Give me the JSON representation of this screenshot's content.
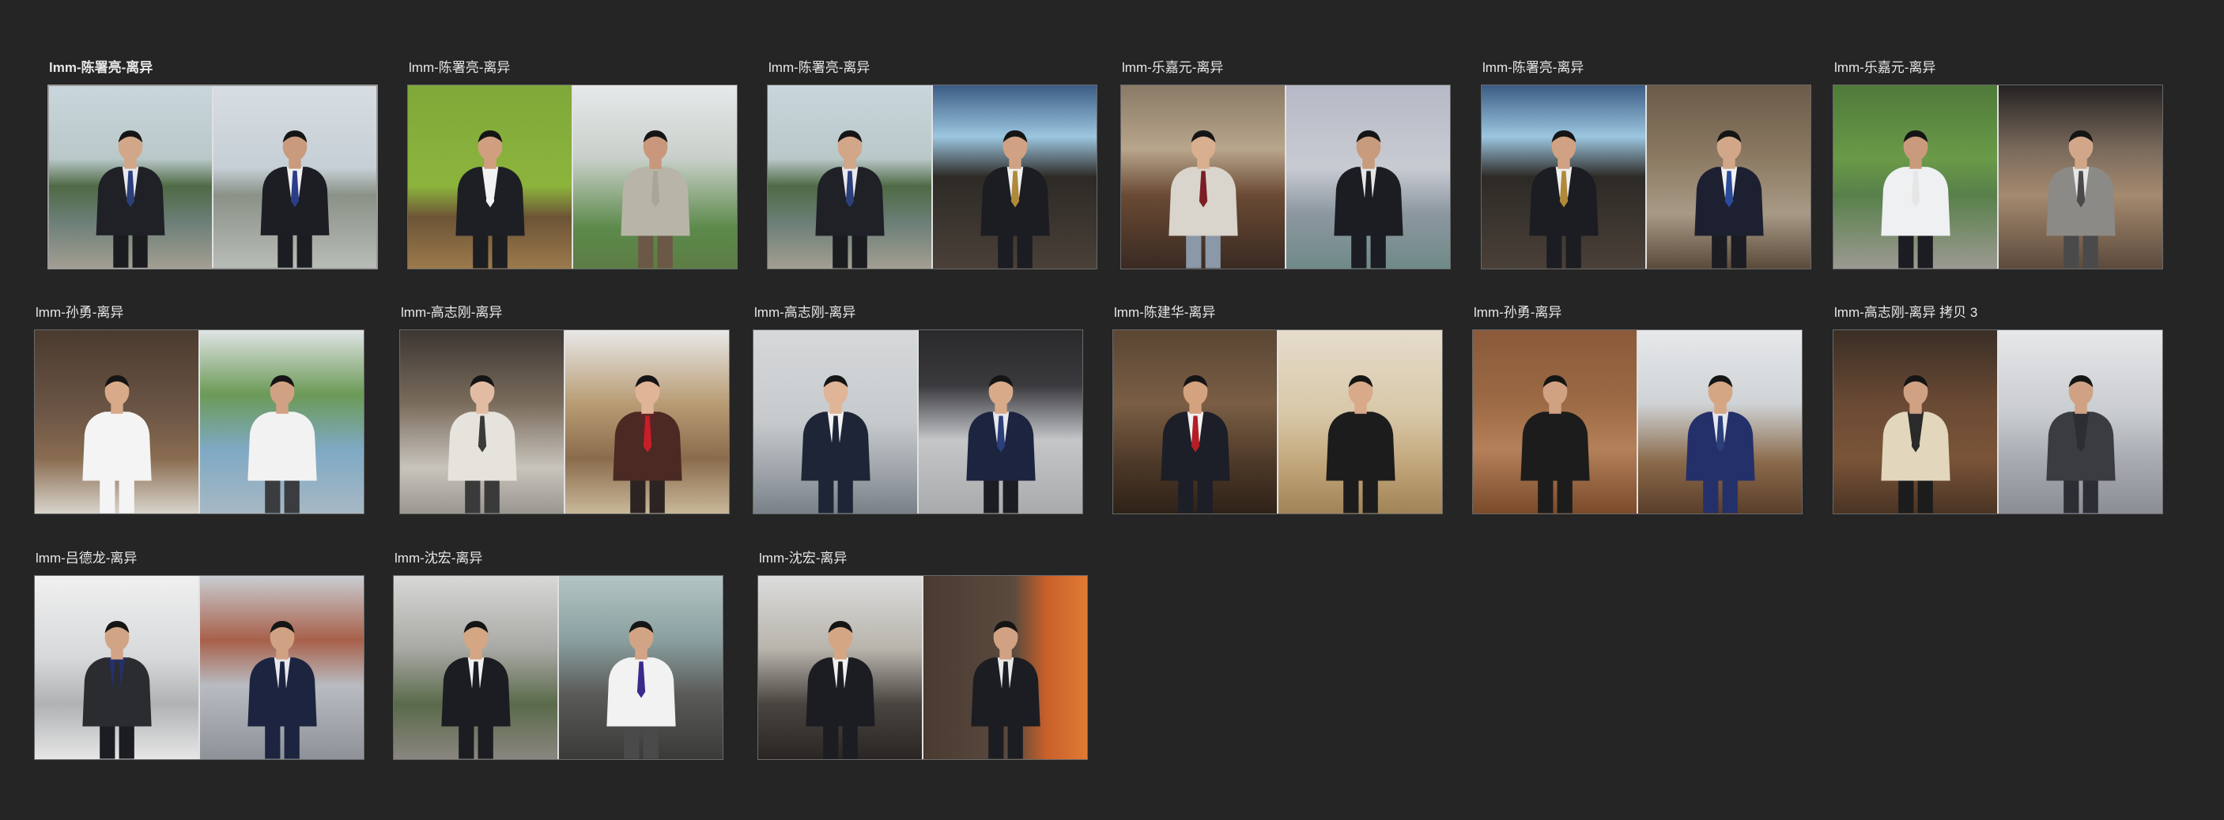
{
  "tiles": [
    {
      "label": "lmm-陈署亮-离异",
      "bold": true,
      "selected": true,
      "photos": [
        {
          "bg": "linear-gradient(180deg,#c9d6dc 0%,#b9c8c9 40%,#4f6a45 55%,#6c7f78 75%,#a39e92 100%)",
          "skin": "#d2a688",
          "shirt": "#e8e8ee",
          "jacket": "#1f2127",
          "tie": "#2b3f7a",
          "pants": "#1b1c20"
        },
        {
          "bg": "linear-gradient(180deg,#d7dde2 0%,#c6cfd6 45%,#8a9187 60%,#b8bdb7 100%)",
          "skin": "#c99a7c",
          "shirt": "#f0f0f0",
          "jacket": "#1c1e24",
          "tie": "#2b3d8a",
          "pants": "#1c1d22"
        }
      ]
    },
    {
      "label": "lmm-陈署亮-离异",
      "bold": false,
      "selected": false,
      "photos": [
        {
          "bg": "linear-gradient(180deg,#7fa83a 0%,#8cb43c 55%,#6d5436 72%,#9b7a4c 100%)",
          "skin": "#cf9f7f",
          "shirt": "#f2f2f2",
          "jacket": "#1e1f25",
          "tie": "#f2f2f2",
          "pants": "#1d1e22"
        },
        {
          "bg": "linear-gradient(180deg,#e6e9ea 0%,#c8cfc9 40%,#5c8a4b 78%,#5d7d45 100%)",
          "skin": "#c9977b",
          "shirt": "#b8b5a8",
          "jacket": "#b8b5a8",
          "tie": "#a9a699",
          "pants": "#6c5846"
        }
      ]
    },
    {
      "label": "lmm-陈署亮-离异",
      "bold": false,
      "selected": false,
      "photos": [
        {
          "bg": "linear-gradient(180deg,#c9d6dc 0%,#b9c8c9 40%,#4f6a45 55%,#6c7f78 75%,#a39e92 100%)",
          "skin": "#d2a688",
          "shirt": "#e8e8ee",
          "jacket": "#1f2127",
          "tie": "#2b3f7a",
          "pants": "#1b1c20"
        },
        {
          "bg": "linear-gradient(180deg,#3b5c84 0%,#9cc6e0 28%,#2d2a26 50%,#4a4038 100%)",
          "skin": "#d0a283",
          "shirt": "#f0f0f0",
          "jacket": "#1c1d22",
          "tie": "#b08a3a",
          "pants": "#1c1d22"
        }
      ]
    },
    {
      "label": "lmm-乐嘉元-离异",
      "bold": false,
      "selected": false,
      "photos": [
        {
          "bg": "linear-gradient(180deg,#8a7a66 0%,#b8a58c 35%,#6a4a34 60%,#3a2a22 100%)",
          "skin": "#d8b08f",
          "shirt": "#d9d4cc",
          "jacket": "#d9d4cc",
          "tie": "#7a1f25",
          "pants": "#8a98a8"
        },
        {
          "bg": "linear-gradient(180deg,#b6b9c6 0%,#c9cbd3 45%,#8c97a0 70%,#6f8a88 100%)",
          "skin": "#c89b7c",
          "shirt": "#e6e6e6",
          "jacket": "#1c1d22",
          "tie": "#1c1d22",
          "pants": "#1c1d22"
        }
      ]
    },
    {
      "label": "lmm-陈署亮-离异",
      "bold": false,
      "selected": false,
      "photos": [
        {
          "bg": "linear-gradient(180deg,#3b5c84 0%,#9cc6e0 28%,#2d2a26 50%,#4a4038 100%)",
          "skin": "#d0a283",
          "shirt": "#f0f0f0",
          "jacket": "#1c1d22",
          "tie": "#b08a3a",
          "pants": "#1c1d22"
        },
        {
          "bg": "linear-gradient(180deg,#6b5a48 0%,#8c7a63 40%,#a89a86 70%,#5a4a3a 100%)",
          "skin": "#d2a688",
          "shirt": "#f2f2f2",
          "jacket": "#1d2030",
          "tie": "#2b4a9a",
          "pants": "#1c1d22"
        }
      ]
    },
    {
      "label": "lmm-乐嘉元-离异",
      "bold": false,
      "selected": false,
      "photos": [
        {
          "bg": "linear-gradient(180deg,#4f7a3a 0%,#6a9a48 40%,#58804a 60%,#9c9a92 100%)",
          "skin": "#c99a7c",
          "shirt": "#eef0f2",
          "jacket": "#eef0f2",
          "tie": "#e6e6e6",
          "pants": "#1c1d22"
        },
        {
          "bg": "linear-gradient(180deg,#242222 0%,#7a6a5c 35%,#a48a6e 60%,#5c4a3c 100%)",
          "skin": "#d2a688",
          "shirt": "#e6e6e6",
          "jacket": "#8c8a86",
          "tie": "#4a4a4a",
          "pants": "#4a4a4a"
        }
      ]
    },
    {
      "label": "lmm-孙勇-离异",
      "bold": false,
      "selected": false,
      "photos": [
        {
          "bg": "linear-gradient(180deg,#4a3a2e 0%,#6c5646 45%,#8a6c50 70%,#d8d4cc 100%)",
          "skin": "#d8aa8a",
          "shirt": "#f4f4f4",
          "jacket": "#f4f4f4",
          "tie": "#f4f4f4",
          "pants": "#f4f4f4"
        },
        {
          "bg": "linear-gradient(180deg,#dfe4e6 0%,#6c9a56 35%,#7ea9c4 65%,#a7b8c4 100%)",
          "skin": "#d0a283",
          "shirt": "#f2f2f2",
          "jacket": "#f2f2f2",
          "tie": "#f2f2f2",
          "pants": "#3a3c40"
        }
      ]
    },
    {
      "label": "lmm-高志刚-离异",
      "bold": false,
      "selected": false,
      "photos": [
        {
          "bg": "linear-gradient(180deg,#3c3632 0%,#7a6c5c 40%,#c8c4bc 75%,#9a9690 100%)",
          "skin": "#e2bca2",
          "shirt": "#e6e2dc",
          "jacket": "#e6e2dc",
          "tie": "#3a3a3a",
          "pants": "#3a3a3a"
        },
        {
          "bg": "linear-gradient(180deg,#e8e8e8 0%,#b89c74 40%,#8a6c4c 70%,#c8b89a 100%)",
          "skin": "#e0b496",
          "shirt": "#5a2424",
          "jacket": "#4a2a22",
          "tie": "#c81e28",
          "pants": "#2c2422"
        }
      ]
    },
    {
      "label": "lmm-高志刚-离异",
      "bold": false,
      "selected": false,
      "photos": [
        {
          "bg": "linear-gradient(180deg,#d6d8da 0%,#c6cacc 50%,#9aa0a6 80%,#7a8088 100%)",
          "skin": "#e0b496",
          "shirt": "#f2f2f2",
          "jacket": "#1e2536",
          "tie": "#1e2536",
          "pants": "#1e2536"
        },
        {
          "bg": "linear-gradient(180deg,#2a2a2c 0%,#3a3a3e 30%,#c4c6c8 60%,#a8aaac 100%)",
          "skin": "#d8aa8a",
          "shirt": "#e8e8ee",
          "jacket": "#1c2440",
          "tie": "#2b3f7a",
          "pants": "#1c1d22"
        }
      ]
    },
    {
      "label": "lmm-陈建华-离异",
      "bold": false,
      "selected": false,
      "photos": [
        {
          "bg": "linear-gradient(180deg,#5a4634 0%,#7a5e44 40%,#4a3626 75%,#2e2218 100%)",
          "skin": "#d4a27e",
          "shirt": "#f2f2f2",
          "jacket": "#1c1e28",
          "tie": "#b41e24",
          "pants": "#1c1e28"
        },
        {
          "bg": "linear-gradient(180deg,#e6dccc 0%,#d8c8a8 45%,#c0a478 75%,#a08458 100%)",
          "skin": "#d8aa8a",
          "shirt": "#1c1c1c",
          "jacket": "#1c1c1c",
          "tie": "#1c1c1c",
          "pants": "#1c1c1c"
        }
      ]
    },
    {
      "label": "lmm-孙勇-离异",
      "bold": false,
      "selected": false,
      "photos": [
        {
          "bg": "linear-gradient(180deg,#8a5a3a 0%,#9c6a44 40%,#b4805a 65%,#7a4a2a 100%)",
          "skin": "#d0a283",
          "shirt": "#1c1c1c",
          "jacket": "#1c1c1c",
          "tie": "#1c1c1c",
          "pants": "#1c1c1c"
        },
        {
          "bg": "linear-gradient(180deg,#e6e8ea 0%,#cfd3d6 40%,#8a6a4a 72%,#5a3e2a 100%)",
          "skin": "#d4a684",
          "shirt": "#e6e8ee",
          "jacket": "#24306a",
          "tie": "#2b3f7a",
          "pants": "#24306a"
        }
      ]
    },
    {
      "label": "lmm-高志刚-离异 拷贝 3",
      "bold": false,
      "selected": false,
      "photos": [
        {
          "bg": "linear-gradient(180deg,#3a2e26 0%,#6a4a34 40%,#7a5438 70%,#4a3424 100%)",
          "skin": "#d0a283",
          "shirt": "#2a2a2a",
          "jacket": "#e2d6bc",
          "tie": "#2a2a2a",
          "pants": "#1c1c1c"
        },
        {
          "bg": "linear-gradient(180deg,#e6e8ea 0%,#c9ccd0 45%,#a8acb2 70%,#8a8e94 100%)",
          "skin": "#d0a283",
          "shirt": "#2c2e34",
          "jacket": "#3a3c42",
          "tie": "#2c2e34",
          "pants": "#2c2e34"
        }
      ]
    },
    {
      "label": "lmm-吕德龙-离异",
      "bold": false,
      "selected": false,
      "photos": [
        {
          "bg": "linear-gradient(180deg,#f0f0f0 0%,#d6d8da 45%,#b0b2b4 70%,#e6e6e6 100%)",
          "skin": "#d2a486",
          "shirt": "#24306a",
          "jacket": "#2a2c30",
          "tie": "#2a2c30",
          "pants": "#1c1d22"
        },
        {
          "bg": "linear-gradient(180deg,#c9cdd2 0%,#a8604a 35%,#b8bcc2 60%,#8e9298 100%)",
          "skin": "#d0a283",
          "shirt": "#e8e8ee",
          "jacket": "#1c2440",
          "tie": "#1c2440",
          "pants": "#1c2440"
        }
      ]
    },
    {
      "label": "lmm-沈宏-离异",
      "bold": false,
      "selected": false,
      "photos": [
        {
          "bg": "linear-gradient(180deg,#d8d8d6 0%,#a8a8a4 40%,#5a6a4a 70%,#8a8680 100%)",
          "skin": "#d4a684",
          "shirt": "#f0f0f0",
          "jacket": "#1c1d22",
          "tie": "#1c1d22",
          "pants": "#1c1d22"
        },
        {
          "bg": "linear-gradient(180deg,#b4c4c4 0%,#8aa0a0 35%,#5a5a58 65%,#3a3a38 100%)",
          "skin": "#d2a486",
          "shirt": "#f2f2f2",
          "jacket": "#f2f2f2",
          "tie": "#3a2a8a",
          "pants": "#4a4a4a"
        }
      ]
    },
    {
      "label": "lmm-沈宏-离异",
      "bold": false,
      "selected": false,
      "photos": [
        {
          "bg": "linear-gradient(180deg,#dcdcdc 0%,#b8b4ac 40%,#4a4440 70%,#2a2624 100%)",
          "skin": "#d4a684",
          "shirt": "#f0f0f0",
          "jacket": "#1c1d22",
          "tie": "#1c1d22",
          "pants": "#1c1d22"
        },
        {
          "bg": "linear-gradient(90deg,#4a3a30 0%,#5a4a3e 55%,#c8602a 75%,#e07a34 100%)",
          "skin": "#d0a283",
          "shirt": "#e8e8e8",
          "jacket": "#1c1d22",
          "tie": "#1c1d22",
          "pants": "#1c1d22"
        }
      ]
    }
  ]
}
